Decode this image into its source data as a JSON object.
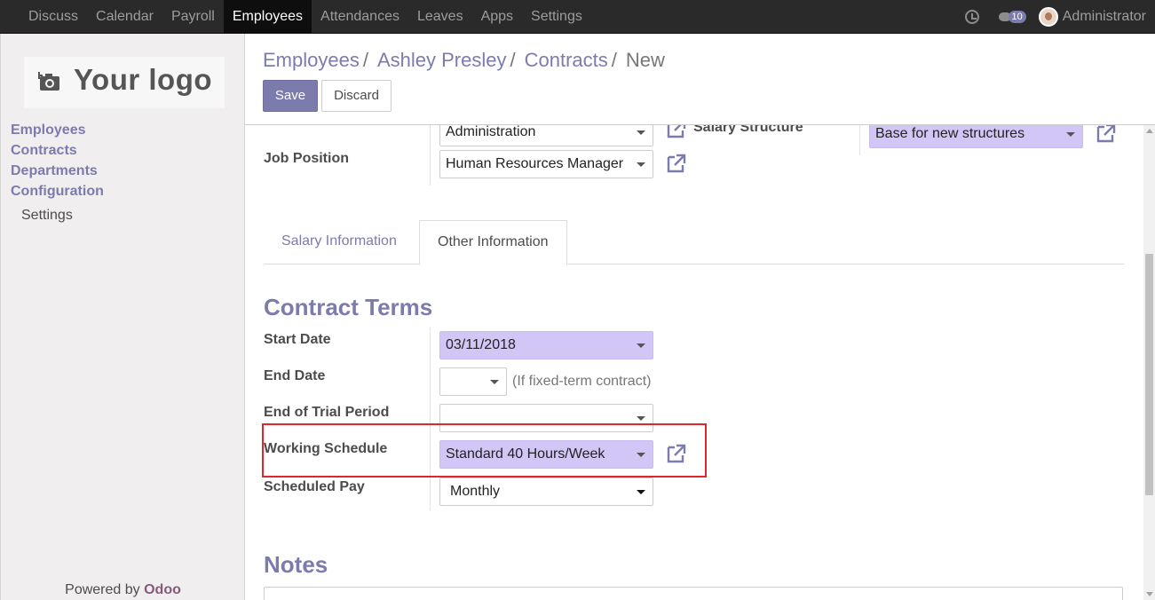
{
  "topbar": {
    "menu": [
      "Discuss",
      "Calendar",
      "Payroll",
      "Employees",
      "Attendances",
      "Leaves",
      "Apps",
      "Settings"
    ],
    "active": "Employees",
    "chat_count": "10",
    "user": "Administrator",
    "icons": [
      "clock-icon",
      "chat-icon",
      "avatar"
    ]
  },
  "sidebar": {
    "logo_text": "Your logo",
    "items": [
      "Employees",
      "Contracts",
      "Departments",
      "Configuration"
    ],
    "sub_item": "Settings",
    "powered_by": "Powered by",
    "powered_brand": "Odoo"
  },
  "breadcrumb": {
    "items": [
      "Employees",
      "Ashley Presley",
      "Contracts"
    ],
    "separator": "/",
    "current": "New"
  },
  "buttons": {
    "save": "Save",
    "discard": "Discard"
  },
  "form": {
    "department_value": "Administration",
    "job_position": {
      "label": "Job Position",
      "value": "Human Resources Manager"
    },
    "salary_structure": {
      "label": "Salary Structure",
      "value": "Base for new structures"
    }
  },
  "tabs": [
    {
      "label": "Salary Information",
      "active": false
    },
    {
      "label": "Other Information",
      "active": true
    }
  ],
  "contract_terms": {
    "title": "Contract Terms",
    "start_date": {
      "label": "Start Date",
      "value": "03/11/2018"
    },
    "end_date": {
      "label": "End Date",
      "value": "",
      "hint": "(If fixed-term contract)"
    },
    "trial_end": {
      "label": "End of Trial Period",
      "value": ""
    },
    "working_schedule": {
      "label": "Working Schedule",
      "value": "Standard 40 Hours/Week"
    },
    "scheduled_pay": {
      "label": "Scheduled Pay",
      "value": "Monthly"
    }
  },
  "notes": {
    "title": "Notes"
  },
  "colors": {
    "accent": "#7c7bad",
    "required": "#d2c6f6",
    "highlight": "#e0262b",
    "navbar": "#2a2a2a"
  }
}
